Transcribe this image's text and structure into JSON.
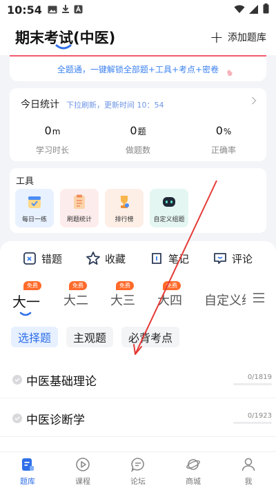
{
  "status_bar": {
    "time": "10:54"
  },
  "header": {
    "title": "期末考试(中医)",
    "add_label": "添加题库"
  },
  "promo": {
    "text": "全题通，一键解锁全部题+工具+考点+密卷"
  },
  "stats": {
    "title": "今日统计",
    "subtitle": "下拉刷新，更新时间 10：54",
    "items": [
      {
        "value": "0",
        "unit": "m",
        "label": "学习时长"
      },
      {
        "value": "0",
        "unit": "题",
        "label": "做题数"
      },
      {
        "value": "0",
        "unit": "%",
        "label": "正确率"
      }
    ]
  },
  "tools": {
    "title": "工具",
    "items": [
      {
        "label": "每日一练",
        "bg": "#e8f1ff",
        "icon": "calendar-check-icon"
      },
      {
        "label": "刷题统计",
        "bg": "#fdecec",
        "icon": "clipboard-list-icon"
      },
      {
        "label": "排行榜",
        "bg": "#fdeee6",
        "icon": "trophy-icon"
      },
      {
        "label": "自定义组题",
        "bg": "#e4f6f1",
        "icon": "robot-icon"
      }
    ]
  },
  "actions": [
    {
      "label": "错题",
      "icon": "wrong-question-icon"
    },
    {
      "label": "收藏",
      "icon": "star-icon"
    },
    {
      "label": "笔记",
      "icon": "note-icon"
    },
    {
      "label": "评论",
      "icon": "comment-icon"
    }
  ],
  "years": {
    "items": [
      {
        "label": "大一",
        "badge": "免费",
        "active": true
      },
      {
        "label": "大二",
        "badge": "免费",
        "active": false
      },
      {
        "label": "大三",
        "badge": "免费",
        "active": false
      },
      {
        "label": "大四",
        "badge": "免费",
        "active": false
      },
      {
        "label": "自定义组",
        "badge": "",
        "active": false
      }
    ]
  },
  "chips": [
    {
      "label": "选择题",
      "active": true
    },
    {
      "label": "主观题",
      "active": false
    },
    {
      "label": "必背考点",
      "active": false
    }
  ],
  "subjects": [
    {
      "name": "中医基础理论",
      "progress": "0/1819",
      "fraction": 0
    },
    {
      "name": "中医诊断学",
      "progress": "0/1923",
      "fraction": 0
    }
  ],
  "nav": [
    {
      "label": "题库",
      "icon": "question-bank-icon",
      "active": true
    },
    {
      "label": "课程",
      "icon": "play-course-icon",
      "active": false
    },
    {
      "label": "论坛",
      "icon": "forum-icon",
      "active": false
    },
    {
      "label": "商城",
      "icon": "shop-planet-icon",
      "active": false
    },
    {
      "label": "我",
      "icon": "profile-icon",
      "active": false
    }
  ],
  "colors": {
    "accent": "#2f6fe8",
    "badge": "#ff6a2a",
    "promo_text": "#3c82f0",
    "annotation": "#e53935"
  }
}
